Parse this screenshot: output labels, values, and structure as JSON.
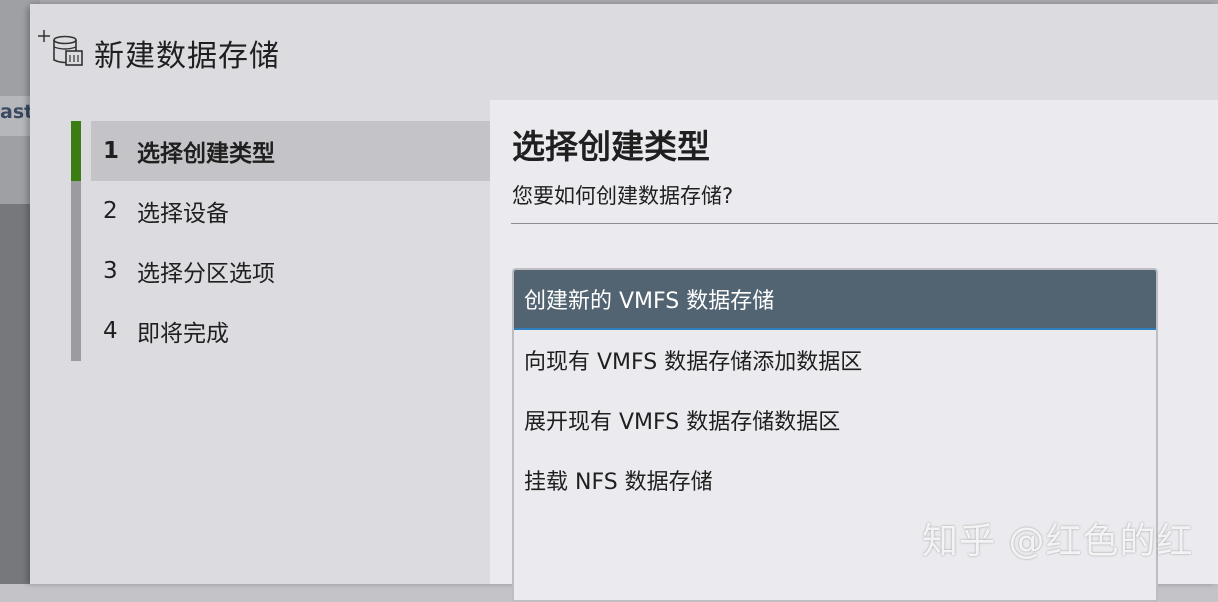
{
  "background": {
    "fragment_text": "ast"
  },
  "dialog": {
    "title": "新建数据存储",
    "title_icon": "new-datastore-icon"
  },
  "steps": [
    {
      "num": "1",
      "label": "选择创建类型",
      "active": true
    },
    {
      "num": "2",
      "label": "选择设备",
      "active": false
    },
    {
      "num": "3",
      "label": "选择分区选项",
      "active": false
    },
    {
      "num": "4",
      "label": "即将完成",
      "active": false
    }
  ],
  "content": {
    "title": "选择创建类型",
    "subtitle": "您要如何创建数据存储?",
    "options": [
      {
        "label": "创建新的 VMFS 数据存储",
        "selected": true
      },
      {
        "label": "向现有 VMFS 数据存储添加数据区",
        "selected": false
      },
      {
        "label": "展开现有 VMFS 数据存储数据区",
        "selected": false
      },
      {
        "label": "挂载 NFS 数据存储",
        "selected": false
      }
    ]
  },
  "watermark": "知乎 @红色的红",
  "colors": {
    "active_step_indicator": "#3b7d12",
    "selected_option_bg": "#526472",
    "selected_option_underline": "#2f7fbf"
  }
}
